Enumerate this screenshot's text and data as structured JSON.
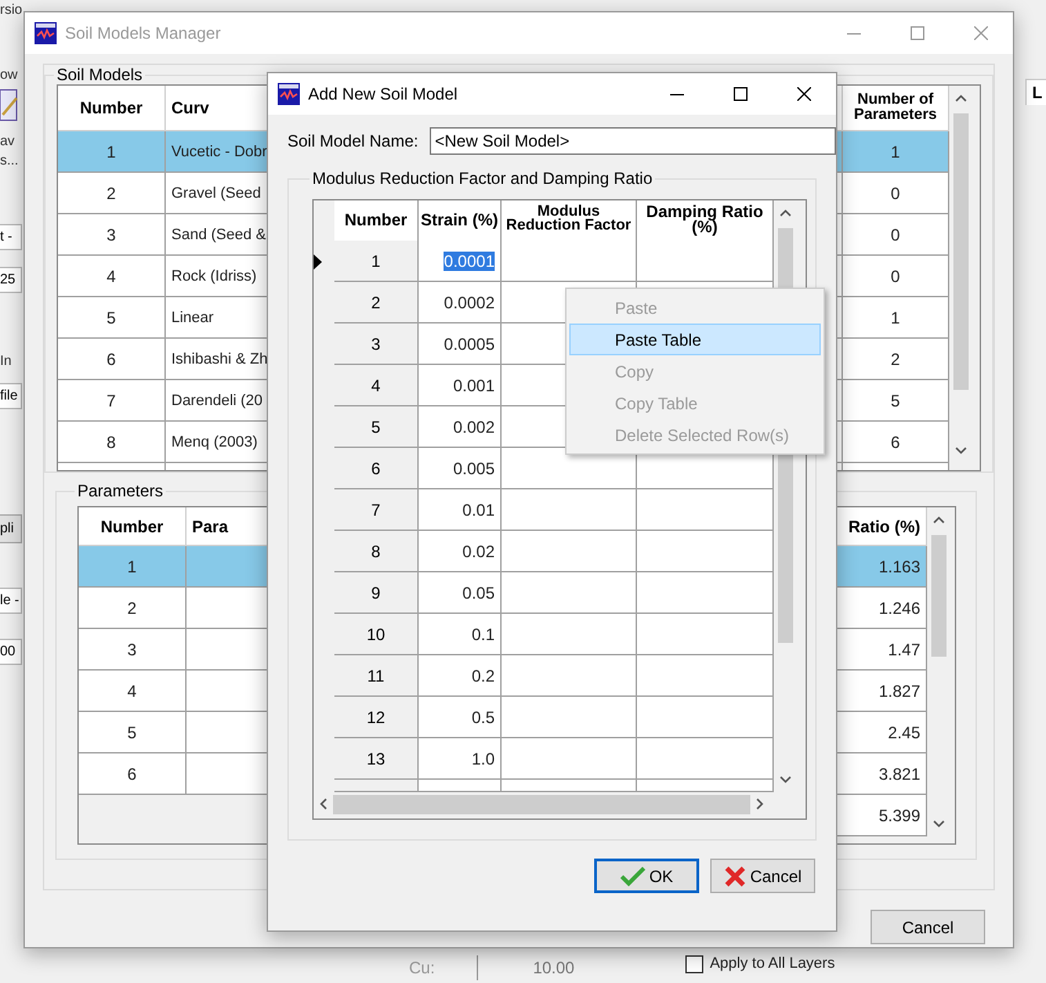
{
  "background_app": {
    "title_fragment": "rsio",
    "left_fragments": [
      {
        "kind": "text",
        "text": "ow"
      },
      {
        "kind": "icon"
      },
      {
        "kind": "text",
        "text": "av"
      },
      {
        "kind": "text",
        "text": "s..."
      },
      {
        "kind": "field",
        "text": "t -"
      },
      {
        "kind": "field",
        "text": "25"
      },
      {
        "kind": "check",
        "text": "In"
      },
      {
        "kind": "field",
        "text": "file"
      },
      {
        "kind": "button",
        "text": "pli"
      },
      {
        "kind": "field",
        "text": "le -"
      },
      {
        "kind": "field",
        "text": "00"
      }
    ],
    "right_tab": "L",
    "bottom": {
      "label": "Cu:",
      "value": "10.00",
      "apply_all": {
        "label": "Apply to All Layers",
        "checked": false
      }
    }
  },
  "manager": {
    "title": "Soil Models Manager",
    "soil_models": {
      "title": "Soil Models",
      "columns": [
        "Number",
        "Curv",
        "Number of Parameters"
      ],
      "rows": [
        {
          "number": "1",
          "curve": "Vucetic - Dobr",
          "parameters": "1",
          "selected": true
        },
        {
          "number": "2",
          "curve": "Gravel (Seed",
          "parameters": "0",
          "selected": false
        },
        {
          "number": "3",
          "curve": "Sand (Seed &",
          "parameters": "0",
          "selected": false
        },
        {
          "number": "4",
          "curve": "Rock (Idriss)",
          "parameters": "0",
          "selected": false
        },
        {
          "number": "5",
          "curve": "Linear",
          "parameters": "1",
          "selected": false
        },
        {
          "number": "6",
          "curve": "Ishibashi & Zh",
          "parameters": "2",
          "selected": false
        },
        {
          "number": "7",
          "curve": "Darendeli (20",
          "parameters": "5",
          "selected": false
        },
        {
          "number": "8",
          "curve": "Menq (2003)",
          "parameters": "6",
          "selected": false
        }
      ]
    },
    "parameters": {
      "title": "Parameters",
      "columns": [
        "Number",
        "Para",
        "Ratio (%)"
      ],
      "rows": [
        {
          "number": "1",
          "damping": "1.163",
          "selected": true
        },
        {
          "number": "2",
          "damping": "1.246",
          "selected": false
        },
        {
          "number": "3",
          "damping": "1.47",
          "selected": false
        },
        {
          "number": "4",
          "damping": "1.827",
          "selected": false
        },
        {
          "number": "5",
          "damping": "2.45",
          "selected": false
        },
        {
          "number": "6",
          "damping": "3.821",
          "selected": false
        },
        {
          "damping": "5.399",
          "selected": false
        }
      ]
    },
    "buttons": [
      "Cancel"
    ]
  },
  "dialog": {
    "title": "Add New Soil Model",
    "name_label": "Soil Model Name:",
    "name_value": "<New Soil Model>",
    "group_title": "Modulus Reduction Factor and Damping Ratio",
    "columns": [
      "Number",
      "Strain (%)",
      "Modulus Reduction Factor",
      "Damping Ratio (%)"
    ],
    "rows": [
      {
        "number": "1",
        "strain": "0.0001",
        "current": true
      },
      {
        "number": "2",
        "strain": "0.0002",
        "current": false
      },
      {
        "number": "3",
        "strain": "0.0005",
        "current": false
      },
      {
        "number": "4",
        "strain": "0.001",
        "current": false
      },
      {
        "number": "5",
        "strain": "0.002",
        "current": false
      },
      {
        "number": "6",
        "strain": "0.005",
        "current": false
      },
      {
        "number": "7",
        "strain": "0.01",
        "current": false
      },
      {
        "number": "8",
        "strain": "0.02",
        "current": false
      },
      {
        "number": "9",
        "strain": "0.05",
        "current": false
      },
      {
        "number": "10",
        "strain": "0.1",
        "current": false
      },
      {
        "number": "11",
        "strain": "0.2",
        "current": false
      },
      {
        "number": "12",
        "strain": "0.5",
        "current": false
      },
      {
        "number": "13",
        "strain": "1.0",
        "current": false
      }
    ],
    "buttons": [
      {
        "kind": "ok",
        "label": "OK",
        "focused": true
      },
      {
        "kind": "cancel",
        "label": "Cancel",
        "focused": false
      }
    ]
  },
  "context_menu": {
    "items": [
      {
        "label": "Paste",
        "disabled": true,
        "selected": false
      },
      {
        "label": "Paste Table",
        "disabled": false,
        "selected": true
      },
      {
        "label": "Copy",
        "disabled": true,
        "selected": false
      },
      {
        "label": "Copy Table",
        "disabled": true,
        "selected": false
      },
      {
        "label": "Delete Selected Row(s)",
        "disabled": true,
        "selected": false
      }
    ]
  }
}
